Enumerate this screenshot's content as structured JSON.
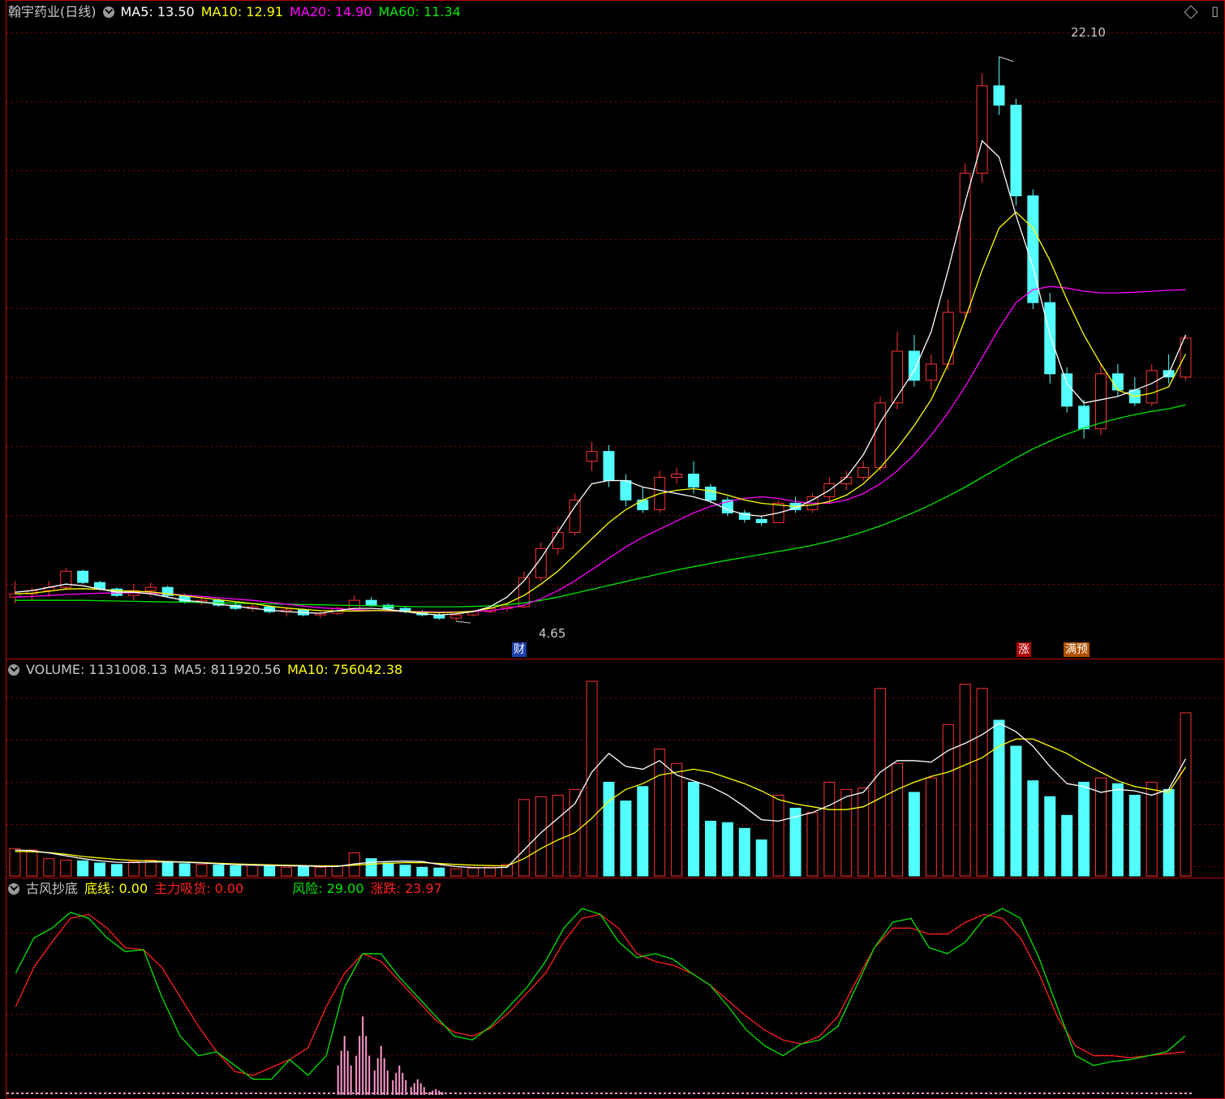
{
  "price_panel": {
    "stock_name": "翰宇药业(日线)",
    "ma5": "MA5: 13.50",
    "ma10": "MA10: 12.91",
    "ma20": "MA20: 14.90",
    "ma60": "MA60: 11.34",
    "high_label": "22.10",
    "low_label": "4.65",
    "event_cai": "财",
    "event_zhang": "涨",
    "event_manyu": "满预"
  },
  "volume_panel": {
    "volume": "VOLUME: 1131008.13",
    "ma5": "MA5: 811920.56",
    "ma10": "MA10: 756042.38"
  },
  "indicator_panel": {
    "name": "古风抄底",
    "bottom_line": "底线: 0.00",
    "main_absorb": "主力吸货: 0.00",
    "risk": "风险: 29.00",
    "change": "涨跌: 23.97"
  },
  "colors": {
    "background": "#000000",
    "up": "#ff3232",
    "down": "#54ffff",
    "ma5": "#ffffff",
    "ma10": "#ffff00",
    "ma20": "#ff00ff",
    "ma60": "#00e600",
    "grid": "#8b0000",
    "frame": "#b40000",
    "pink_bar": "#ff99cc"
  },
  "chart_data": [
    {
      "type": "candlestick",
      "title": "翰宇药业(日线)",
      "ylim": [
        3.8,
        23.1
      ],
      "annotations": {
        "max": 22.1,
        "min": 4.65
      },
      "candles": [
        {
          "o": 5.4,
          "h": 5.9,
          "l": 5.2,
          "c": 5.5
        },
        {
          "o": 5.5,
          "h": 5.7,
          "l": 5.3,
          "c": 5.6
        },
        {
          "o": 5.6,
          "h": 5.9,
          "l": 5.4,
          "c": 5.7
        },
        {
          "o": 5.7,
          "h": 6.3,
          "l": 5.6,
          "c": 6.2
        },
        {
          "o": 6.2,
          "h": 6.25,
          "l": 5.8,
          "c": 5.85
        },
        {
          "o": 5.85,
          "h": 5.9,
          "l": 5.6,
          "c": 5.65
        },
        {
          "o": 5.65,
          "h": 5.7,
          "l": 5.4,
          "c": 5.45
        },
        {
          "o": 5.45,
          "h": 5.8,
          "l": 5.3,
          "c": 5.6
        },
        {
          "o": 5.6,
          "h": 5.85,
          "l": 5.4,
          "c": 5.7
        },
        {
          "o": 5.7,
          "h": 5.75,
          "l": 5.4,
          "c": 5.45
        },
        {
          "o": 5.45,
          "h": 5.5,
          "l": 5.2,
          "c": 5.25
        },
        {
          "o": 5.25,
          "h": 5.4,
          "l": 5.15,
          "c": 5.3
        },
        {
          "o": 5.3,
          "h": 5.35,
          "l": 5.1,
          "c": 5.15
        },
        {
          "o": 5.15,
          "h": 5.25,
          "l": 5.0,
          "c": 5.05
        },
        {
          "o": 5.05,
          "h": 5.2,
          "l": 4.95,
          "c": 5.1
        },
        {
          "o": 5.1,
          "h": 5.15,
          "l": 4.9,
          "c": 4.95
        },
        {
          "o": 4.95,
          "h": 5.1,
          "l": 4.8,
          "c": 5.0
        },
        {
          "o": 5.0,
          "h": 5.05,
          "l": 4.8,
          "c": 4.85
        },
        {
          "o": 4.85,
          "h": 5.0,
          "l": 4.75,
          "c": 4.9
        },
        {
          "o": 4.9,
          "h": 5.1,
          "l": 4.85,
          "c": 5.05
        },
        {
          "o": 5.05,
          "h": 5.45,
          "l": 5.0,
          "c": 5.3
        },
        {
          "o": 5.3,
          "h": 5.4,
          "l": 5.1,
          "c": 5.15
        },
        {
          "o": 5.15,
          "h": 5.2,
          "l": 5.0,
          "c": 5.05
        },
        {
          "o": 5.05,
          "h": 5.1,
          "l": 4.9,
          "c": 4.95
        },
        {
          "o": 4.95,
          "h": 5.0,
          "l": 4.8,
          "c": 4.85
        },
        {
          "o": 4.85,
          "h": 4.9,
          "l": 4.7,
          "c": 4.75
        },
        {
          "o": 4.75,
          "h": 4.9,
          "l": 4.65,
          "c": 4.85
        },
        {
          "o": 4.85,
          "h": 5.0,
          "l": 4.8,
          "c": 4.95
        },
        {
          "o": 4.95,
          "h": 5.1,
          "l": 4.9,
          "c": 5.05
        },
        {
          "o": 5.05,
          "h": 5.15,
          "l": 4.95,
          "c": 5.1
        },
        {
          "o": 5.1,
          "h": 6.2,
          "l": 5.05,
          "c": 6.0
        },
        {
          "o": 6.0,
          "h": 7.1,
          "l": 5.9,
          "c": 6.9
        },
        {
          "o": 6.9,
          "h": 7.6,
          "l": 6.7,
          "c": 7.4
        },
        {
          "o": 7.4,
          "h": 8.6,
          "l": 7.3,
          "c": 8.4
        },
        {
          "o": 9.6,
          "h": 10.2,
          "l": 9.3,
          "c": 9.9
        },
        {
          "o": 9.9,
          "h": 10.1,
          "l": 8.8,
          "c": 9.0
        },
        {
          "o": 9.0,
          "h": 9.2,
          "l": 8.2,
          "c": 8.4
        },
        {
          "o": 8.4,
          "h": 8.8,
          "l": 8.0,
          "c": 8.1
        },
        {
          "o": 8.1,
          "h": 9.3,
          "l": 8.0,
          "c": 9.1
        },
        {
          "o": 9.1,
          "h": 9.4,
          "l": 8.9,
          "c": 9.2
        },
        {
          "o": 9.2,
          "h": 9.6,
          "l": 8.6,
          "c": 8.8
        },
        {
          "o": 8.8,
          "h": 8.9,
          "l": 8.3,
          "c": 8.4
        },
        {
          "o": 8.4,
          "h": 8.5,
          "l": 7.9,
          "c": 8.0
        },
        {
          "o": 8.0,
          "h": 8.1,
          "l": 7.7,
          "c": 7.8
        },
        {
          "o": 7.8,
          "h": 7.9,
          "l": 7.6,
          "c": 7.7
        },
        {
          "o": 7.7,
          "h": 8.4,
          "l": 7.7,
          "c": 8.3
        },
        {
          "o": 8.3,
          "h": 8.5,
          "l": 8.0,
          "c": 8.1
        },
        {
          "o": 8.1,
          "h": 8.6,
          "l": 8.0,
          "c": 8.5
        },
        {
          "o": 8.5,
          "h": 9.1,
          "l": 8.3,
          "c": 8.9
        },
        {
          "o": 8.9,
          "h": 9.3,
          "l": 8.7,
          "c": 9.1
        },
        {
          "o": 9.1,
          "h": 9.6,
          "l": 9.0,
          "c": 9.4
        },
        {
          "o": 9.4,
          "h": 11.6,
          "l": 9.3,
          "c": 11.4
        },
        {
          "o": 11.4,
          "h": 13.6,
          "l": 11.2,
          "c": 13.0
        },
        {
          "o": 13.0,
          "h": 13.5,
          "l": 11.9,
          "c": 12.1
        },
        {
          "o": 12.1,
          "h": 12.9,
          "l": 11.8,
          "c": 12.6
        },
        {
          "o": 12.6,
          "h": 14.6,
          "l": 12.4,
          "c": 14.2
        },
        {
          "o": 14.2,
          "h": 18.8,
          "l": 14.0,
          "c": 18.5
        },
        {
          "o": 18.5,
          "h": 21.6,
          "l": 18.2,
          "c": 21.2
        },
        {
          "o": 21.2,
          "h": 22.1,
          "l": 20.3,
          "c": 20.6
        },
        {
          "o": 20.6,
          "h": 20.8,
          "l": 17.5,
          "c": 17.8
        },
        {
          "o": 17.8,
          "h": 18.0,
          "l": 14.3,
          "c": 14.5
        },
        {
          "o": 14.5,
          "h": 14.8,
          "l": 12.0,
          "c": 12.3
        },
        {
          "o": 12.3,
          "h": 12.5,
          "l": 11.1,
          "c": 11.3
        },
        {
          "o": 11.3,
          "h": 11.5,
          "l": 10.3,
          "c": 10.6
        },
        {
          "o": 10.6,
          "h": 12.6,
          "l": 10.4,
          "c": 12.3
        },
        {
          "o": 12.3,
          "h": 12.6,
          "l": 11.6,
          "c": 11.8
        },
        {
          "o": 11.8,
          "h": 12.2,
          "l": 11.3,
          "c": 11.4
        },
        {
          "o": 11.4,
          "h": 12.6,
          "l": 11.3,
          "c": 12.4
        },
        {
          "o": 12.4,
          "h": 12.9,
          "l": 12.0,
          "c": 12.2
        },
        {
          "o": 12.2,
          "h": 13.5,
          "l": 12.1,
          "c": 13.4
        }
      ],
      "ma5": [
        5.55,
        5.6,
        5.7,
        5.8,
        5.75,
        5.65,
        5.55,
        5.55,
        5.5,
        5.4,
        5.3,
        5.25,
        5.18,
        5.12,
        5.05,
        5.0,
        4.95,
        4.92,
        4.9,
        4.98,
        5.05,
        5.05,
        5.02,
        4.95,
        4.88,
        4.85,
        4.88,
        4.95,
        5.1,
        5.4,
        5.9,
        6.6,
        7.4,
        8.2,
        8.9,
        9.0,
        9.0,
        8.8,
        8.7,
        8.6,
        8.5,
        8.35,
        8.1,
        7.95,
        7.9,
        8.0,
        8.15,
        8.4,
        8.7,
        9.1,
        9.8,
        10.8,
        11.6,
        12.4,
        13.6,
        15.5,
        17.6,
        19.5,
        19.0,
        17.2,
        15.6,
        13.5,
        12.0,
        11.4,
        11.5,
        11.6,
        11.8,
        12.0,
        12.3,
        13.5
      ],
      "ma10": [
        5.5,
        5.52,
        5.58,
        5.65,
        5.66,
        5.64,
        5.6,
        5.58,
        5.56,
        5.5,
        5.44,
        5.38,
        5.32,
        5.26,
        5.2,
        5.12,
        5.06,
        5.02,
        4.98,
        4.97,
        4.97,
        4.98,
        4.98,
        4.96,
        4.93,
        4.92,
        4.93,
        4.96,
        5.05,
        5.2,
        5.45,
        5.8,
        6.2,
        6.7,
        7.2,
        7.7,
        8.1,
        8.4,
        8.6,
        8.7,
        8.75,
        8.68,
        8.55,
        8.4,
        8.3,
        8.25,
        8.2,
        8.25,
        8.35,
        8.55,
        8.9,
        9.4,
        10.0,
        10.7,
        11.5,
        12.6,
        14.0,
        15.5,
        16.8,
        17.3,
        16.8,
        15.8,
        14.6,
        13.5,
        12.6,
        11.8,
        11.6,
        11.7,
        11.9,
        12.91
      ],
      "ma20": [
        5.4,
        5.42,
        5.45,
        5.48,
        5.5,
        5.52,
        5.53,
        5.53,
        5.52,
        5.5,
        5.46,
        5.42,
        5.38,
        5.34,
        5.3,
        5.24,
        5.18,
        5.12,
        5.07,
        5.04,
        5.01,
        4.99,
        4.97,
        4.96,
        4.95,
        4.94,
        4.94,
        4.95,
        4.98,
        5.05,
        5.15,
        5.35,
        5.6,
        5.9,
        6.25,
        6.6,
        6.95,
        7.25,
        7.5,
        7.75,
        8.0,
        8.2,
        8.35,
        8.45,
        8.5,
        8.45,
        8.35,
        8.3,
        8.3,
        8.4,
        8.6,
        8.9,
        9.3,
        9.8,
        10.4,
        11.1,
        11.9,
        12.8,
        13.7,
        14.5,
        14.9,
        15.0,
        14.95,
        14.85,
        14.8,
        14.8,
        14.82,
        14.85,
        14.88,
        14.9
      ],
      "ma60": [
        5.3,
        5.3,
        5.3,
        5.3,
        5.3,
        5.29,
        5.28,
        5.27,
        5.26,
        5.25,
        5.24,
        5.23,
        5.22,
        5.21,
        5.2,
        5.19,
        5.18,
        5.17,
        5.16,
        5.15,
        5.14,
        5.13,
        5.12,
        5.11,
        5.1,
        5.1,
        5.1,
        5.11,
        5.13,
        5.16,
        5.22,
        5.3,
        5.4,
        5.52,
        5.64,
        5.76,
        5.88,
        6.0,
        6.12,
        6.24,
        6.34,
        6.44,
        6.54,
        6.63,
        6.72,
        6.81,
        6.9,
        7.0,
        7.12,
        7.26,
        7.42,
        7.6,
        7.8,
        8.02,
        8.26,
        8.52,
        8.8,
        9.1,
        9.4,
        9.7,
        9.98,
        10.22,
        10.44,
        10.62,
        10.78,
        10.92,
        11.04,
        11.14,
        11.22,
        11.34
      ]
    },
    {
      "type": "bar",
      "title": "VOLUME",
      "ylim": [
        0,
        1350000
      ],
      "values": [
        190000,
        180000,
        120000,
        110000,
        105000,
        90000,
        80000,
        100000,
        110000,
        100000,
        85000,
        80000,
        75000,
        70000,
        80000,
        70000,
        60000,
        65000,
        60000,
        70000,
        160000,
        120000,
        90000,
        75000,
        60000,
        55000,
        50000,
        55000,
        60000,
        80000,
        530000,
        550000,
        560000,
        600000,
        1350000,
        650000,
        520000,
        620000,
        880000,
        780000,
        650000,
        380000,
        370000,
        330000,
        250000,
        560000,
        470000,
        440000,
        650000,
        600000,
        610000,
        1300000,
        780000,
        580000,
        680000,
        1050000,
        1330000,
        1300000,
        1080000,
        900000,
        660000,
        550000,
        420000,
        650000,
        680000,
        640000,
        560000,
        650000,
        600000,
        1131008
      ],
      "ma5": [
        180000,
        175000,
        160000,
        140000,
        120000,
        105000,
        95000,
        93000,
        96000,
        98000,
        95000,
        90000,
        84000,
        78000,
        75000,
        73000,
        71000,
        69000,
        66000,
        65000,
        83000,
        95000,
        100000,
        103000,
        100000,
        80000,
        65000,
        58000,
        56000,
        60000,
        180000,
        300000,
        400000,
        500000,
        720000,
        850000,
        760000,
        740000,
        800000,
        700000,
        660000,
        620000,
        560000,
        480000,
        390000,
        380000,
        410000,
        440000,
        490000,
        550000,
        580000,
        720000,
        800000,
        800000,
        790000,
        870000,
        920000,
        980000,
        1060000,
        1000000,
        900000,
        760000,
        640000,
        620000,
        580000,
        600000,
        590000,
        560000,
        600000,
        811920
      ],
      "ma10": [
        170000,
        168000,
        162000,
        150000,
        135000,
        125000,
        115000,
        108000,
        104000,
        100000,
        97000,
        93000,
        88000,
        84000,
        80000,
        77000,
        74000,
        72000,
        70000,
        69000,
        75000,
        82000,
        88000,
        92000,
        93000,
        86000,
        80000,
        75000,
        72000,
        70000,
        120000,
        190000,
        250000,
        300000,
        400000,
        520000,
        600000,
        640000,
        700000,
        720000,
        740000,
        720000,
        680000,
        640000,
        590000,
        530000,
        500000,
        480000,
        460000,
        460000,
        480000,
        540000,
        600000,
        650000,
        690000,
        720000,
        770000,
        820000,
        900000,
        950000,
        950000,
        900000,
        850000,
        780000,
        720000,
        660000,
        620000,
        600000,
        580000,
        756042
      ]
    },
    {
      "type": "line",
      "title": "古风抄底",
      "ylim": [
        0,
        100
      ],
      "series": [
        {
          "name": "风险",
          "values": [
            62,
            80,
            85,
            93,
            90,
            80,
            73,
            74,
            50,
            30,
            20,
            22,
            15,
            8,
            8,
            18,
            10,
            20,
            55,
            72,
            72,
            60,
            50,
            40,
            30,
            28,
            35,
            45,
            55,
            68,
            85,
            95,
            92,
            78,
            70,
            72,
            69,
            62,
            56,
            45,
            33,
            25,
            20,
            26,
            28,
            35,
            55,
            75,
            88,
            90,
            75,
            72,
            78,
            90,
            95,
            90,
            70,
            45,
            20,
            15,
            17,
            18,
            20,
            22,
            30
          ]
        },
        {
          "name": "涨跌",
          "values": [
            45,
            65,
            78,
            90,
            92,
            85,
            75,
            74,
            65,
            50,
            35,
            22,
            12,
            10,
            14,
            18,
            24,
            45,
            62,
            72,
            68,
            58,
            48,
            38,
            32,
            30,
            34,
            42,
            52,
            62,
            78,
            90,
            92,
            85,
            72,
            68,
            66,
            62,
            56,
            48,
            40,
            33,
            28,
            26,
            30,
            40,
            58,
            75,
            85,
            85,
            82,
            82,
            88,
            92,
            90,
            80,
            62,
            40,
            25,
            20,
            20,
            19,
            20,
            21,
            22
          ]
        }
      ],
      "pink_bars": [
        0,
        0,
        0,
        0,
        0,
        0,
        0,
        0,
        0,
        0,
        0,
        0,
        0,
        0,
        0,
        0,
        0,
        0,
        30,
        40,
        25,
        15,
        8,
        3,
        0,
        0,
        0,
        0,
        0,
        0,
        0,
        0,
        0,
        0,
        0,
        0,
        0,
        0,
        0,
        0,
        0,
        0,
        0,
        0,
        0,
        0,
        0,
        0,
        0,
        0,
        0,
        0,
        0,
        0,
        0,
        0,
        0,
        0,
        0,
        0,
        0,
        0,
        0,
        0,
        0
      ]
    }
  ]
}
